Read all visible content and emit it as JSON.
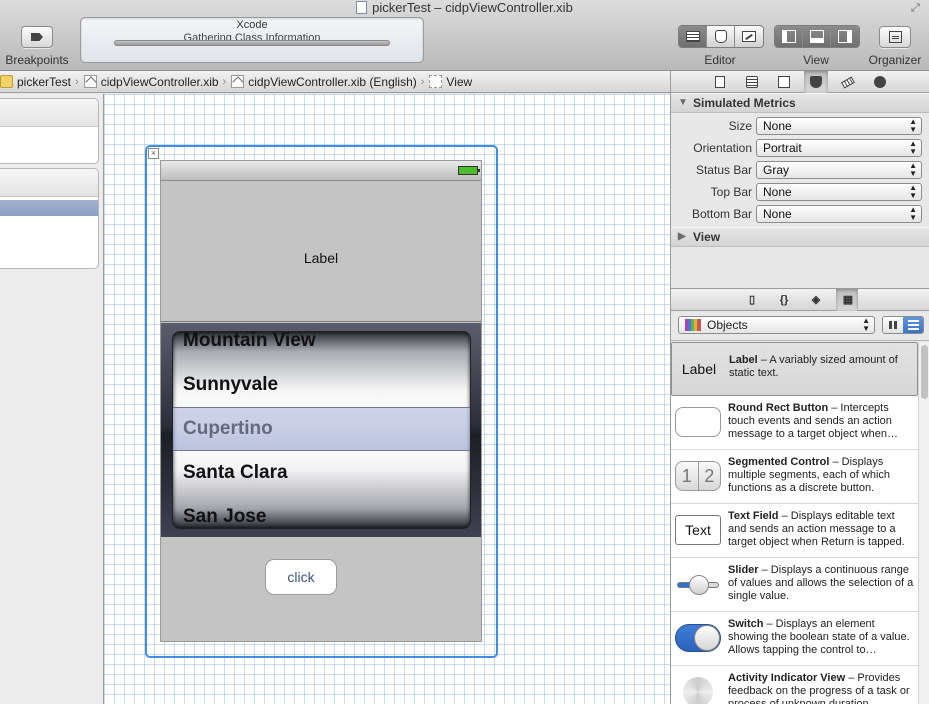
{
  "window": {
    "title": "pickerTest – cidpViewController.xib"
  },
  "toolbar": {
    "breakpoints_label": "Breakpoints",
    "activity_title": "Xcode",
    "activity_status": "Gathering Class Information",
    "editor_label": "Editor",
    "view_label": "View",
    "organizer_label": "Organizer"
  },
  "jumpbar": {
    "crumbs": [
      "pickerTest",
      "cidpViewController.xib",
      "cidpViewController.xib (English)",
      "View"
    ]
  },
  "canvas": {
    "label_text": "Label",
    "picker_rows": [
      "Mountain View",
      "Sunnyvale",
      "Cupertino",
      "Santa Clara",
      "San Jose"
    ],
    "picker_selected": "Cupertino",
    "button_text": "click"
  },
  "inspector": {
    "simulated_metrics_title": "Simulated Metrics",
    "metrics": [
      {
        "label": "Size",
        "value": "None"
      },
      {
        "label": "Orientation",
        "value": "Portrait"
      },
      {
        "label": "Status Bar",
        "value": "Gray"
      },
      {
        "label": "Top Bar",
        "value": "None"
      },
      {
        "label": "Bottom Bar",
        "value": "None"
      }
    ],
    "view_section_title": "View"
  },
  "library": {
    "filter_value": "Objects",
    "items": [
      {
        "name": "Label",
        "desc": " – A variably sized amount of static text.",
        "thumb_text": "Label"
      },
      {
        "name": "Round Rect Button",
        "desc": " – Intercepts touch events and sends an action message to a target object when…"
      },
      {
        "name": "Segmented Control",
        "desc": " – Displays multiple segments, each of which functions as a discrete button.",
        "thumb_segments": [
          "1",
          "2"
        ]
      },
      {
        "name": "Text Field",
        "desc": " – Displays editable text and sends an action message to a target object when Return is tapped.",
        "thumb_text": "Text"
      },
      {
        "name": "Slider",
        "desc": " – Displays a continuous range of values and allows the selection of a single value."
      },
      {
        "name": "Switch",
        "desc": " – Displays an element showing the boolean state of a value. Allows tapping the control to…"
      },
      {
        "name": "Activity Indicator View",
        "desc": " – Provides feedback on the progress of a task or process of unknown duration."
      }
    ]
  },
  "colors": {
    "selection_blue": "#3f8ee6",
    "switch_blue": "#3f7dd8"
  }
}
